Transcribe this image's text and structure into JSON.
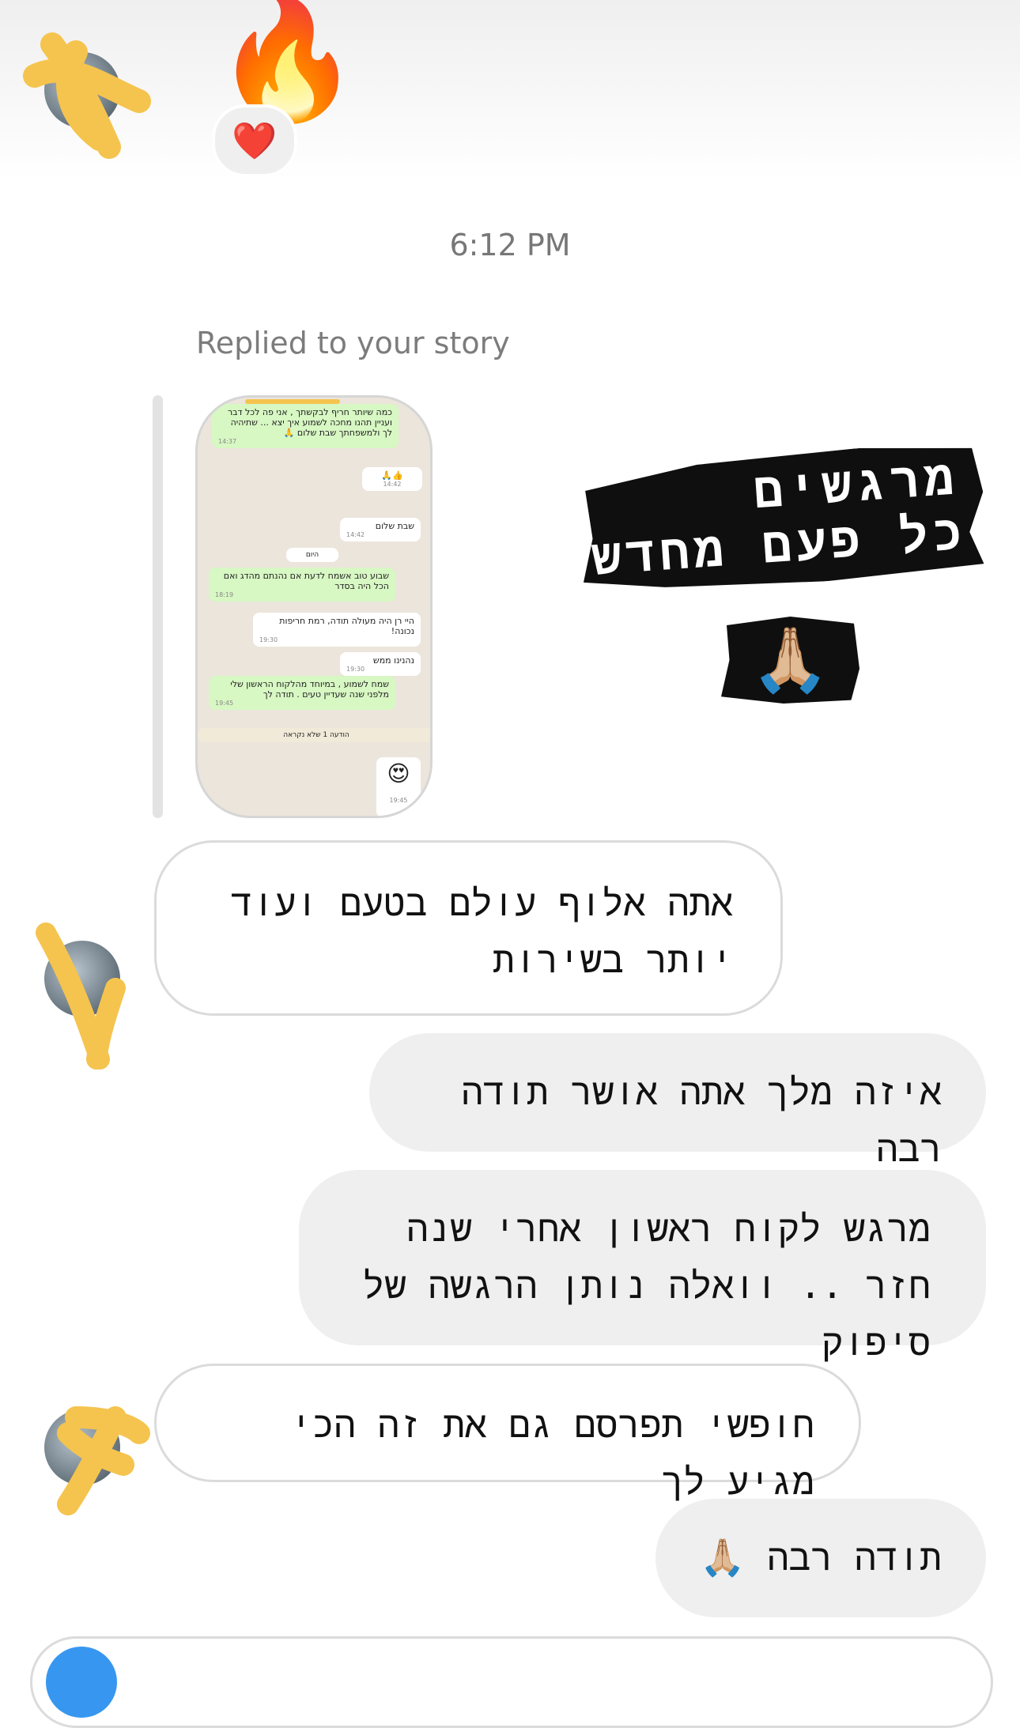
{
  "reactions": {
    "emoji": "🔥",
    "heart": "❤️"
  },
  "timestamp": "6:12 PM",
  "reply_label": "Replied to your story",
  "story_screenshot": {
    "messages": [
      {
        "side": "green",
        "text": "כמה שיותר חריף לבקשתך , אני פה לכל דבר ועניין תהנו מחכה לשמוע איך יצא ... שתיהיה לך ולמשפחתך שבת שלום 🙏",
        "time": "14:37"
      },
      {
        "side": "white",
        "text": "👍🙏",
        "time": "14:42"
      },
      {
        "side": "white",
        "text": "שבת שלום",
        "time": "14:42"
      },
      {
        "side": "date",
        "text": "היום",
        "time": ""
      },
      {
        "side": "green",
        "text": "שבוע טוב אשמח לדעת אם נהנתם מהדג ואם הכל היה בסדר",
        "time": "18:19"
      },
      {
        "side": "white",
        "text": "היי רן היה מעולה תודה, רמת חריפות נכונה!",
        "time": "19:30"
      },
      {
        "side": "white",
        "text": "נהנינו ממש",
        "time": "19:30"
      },
      {
        "side": "green",
        "text": "שמח לשמוע , במיוחד מהלקוח הראשון שלי מלפני שנה שעדיין טעים . תודה לך",
        "time": "19:45"
      },
      {
        "side": "notice",
        "text": "הודעה 1 שלא נקראה",
        "time": ""
      },
      {
        "side": "white",
        "text": "😍",
        "time": "19:45"
      }
    ]
  },
  "story_overlay": {
    "line1": "מרגשים",
    "line2": "כל פעם מחדש",
    "emoji": "🙏🏼"
  },
  "messages": [
    {
      "direction": "incoming",
      "text": "אתה אלוף עולם בטעם ועוד יותר בשירות"
    },
    {
      "direction": "outgoing",
      "text": "איזה מלך אתה אושר תודה רבה"
    },
    {
      "direction": "outgoing",
      "text": "מרגש לקוח ראשון אחרי שנה חזר .. וואלה נותן הרגשה של סיפוק"
    },
    {
      "direction": "incoming",
      "text": "חופשי תפרסם גם את זה הכי מגיע לך"
    },
    {
      "direction": "outgoing",
      "text": "תודה רבה 🙏🏼"
    }
  ],
  "colors": {
    "scribble": "#f5c44e",
    "outgoing_bubble": "#efefef",
    "incoming_border": "#dbdbdb",
    "whatsapp_green": "#d7f7c3",
    "accent": "#3797f0"
  }
}
